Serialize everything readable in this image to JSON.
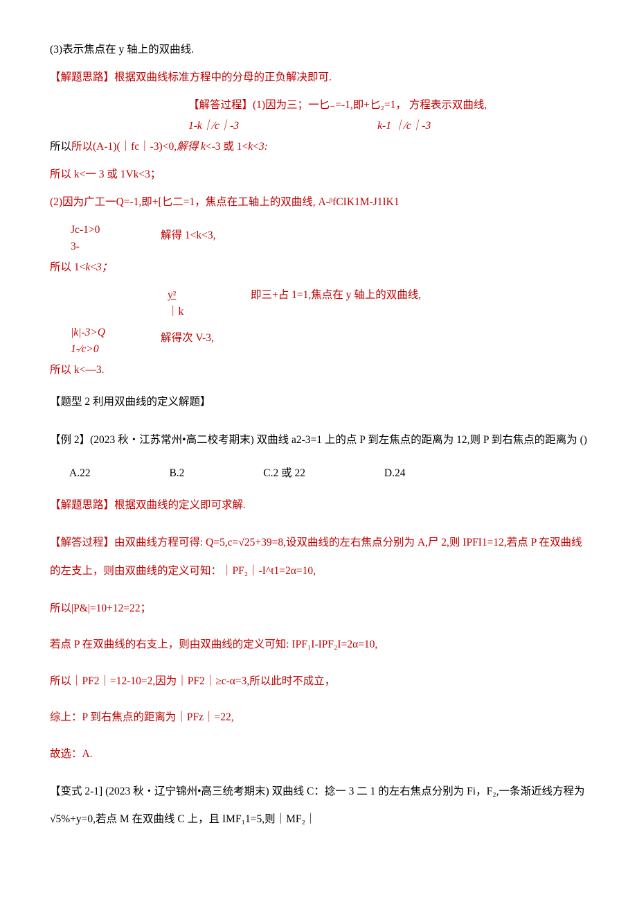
{
  "p1": "(3)表示焦点在 y 轴上的双曲线.",
  "p2": "【解题思路】根据双曲线标准方程中的分母的正负解决即可.",
  "p3a": "【解答过程】(1)因为三；一匕₋=-1,即+匕₂=1，",
  "p3b": "方程表示双曲线,",
  "p3c_left": "1-k｜⁄c｜-3",
  "p3c_right": "k-1     ｜⁄c｜-3",
  "p4": "所以(A-1)(｜fc｜-3)<0,解得 k<-3 或 1<k<3:",
  "p4_suffix": "",
  "p5": "所以 k<一 3 或 1Vk<3；",
  "p6": "(2)因为广工一Q=-1,即+[匕二=1，焦点在工轴上的双曲线, A-ᵝfCIK1M-J1IK1",
  "p7_left": "Jc-1>0\n3-",
  "p7_right": "解得 1<k<3,",
  "p8": "所以 1<k<3；",
  "p9_left_top": "y²",
  "p9_left_bot": "｜k",
  "p9_right": "即三+占 1=1,焦点在 y 轴上的双曲线,",
  "p10_left": "|k|-3>Q\n1-⁄c>0",
  "p10_right": "解得次 V-3,",
  "p11": "所以 k<—3.",
  "h2": "【题型 2 利用双曲线的定义解题】",
  "p12": "【例 2】(2023 秋・江苏常州•高二校考期末) 双曲线 a2-3=1 上的点 P 到左焦点的距离为 12,则 P 到右焦点的距离为 ()",
  "optA": "A.22",
  "optB": "B.2",
  "optC": "C.2 或 22",
  "optD": "D.24",
  "p13": "【解题思路】根据双曲线的定义即可求解.",
  "p14": "【解答过程】由双曲线方程可得: Q=5,c=√25+39=8,设双曲线的左右焦点分别为 A,尸 2,则 IPFI1=12,若点 P 在双曲线的左支上，则由双曲线的定义可知：｜PF₂｜-I^t1=2α=10,",
  "p15": "所以|P&|=10+12=22；",
  "p16": "若点 P 在双曲线的右支上，则由双曲线的定义可知: IPF₁I-IPF₂I=2α=10,",
  "p17": "所以｜PF2｜=12-10=2,因为｜PF2｜≥c-α=3,所以此时不成立，",
  "p18": "综上：P 到右焦点的距离为｜PFz｜=22,",
  "p19": "故选：A.",
  "p20": "【变式 2-1] (2023 秋・辽宁锦州•高三统考期末) 双曲线 C：捻一 3 二 1 的左右焦点分别为 Fi，F₂,一条渐近线方程为√5%+y=0,若点 M 在双曲线 C 上，且 IMF₁1=5,则｜MF₂｜"
}
